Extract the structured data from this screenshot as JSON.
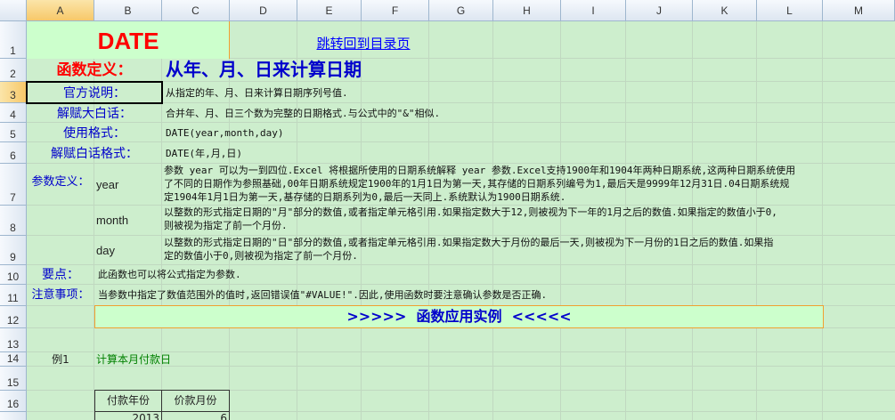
{
  "columns": [
    "A",
    "B",
    "C",
    "D",
    "E",
    "F",
    "G",
    "H",
    "I",
    "J",
    "K",
    "L",
    "M"
  ],
  "rows": [
    "1",
    "2",
    "3",
    "4",
    "5",
    "6",
    "7",
    "8",
    "9",
    "10",
    "11",
    "12",
    "13",
    "14",
    "15",
    "16",
    "17"
  ],
  "colors": {
    "accent_red": "#ff0000",
    "label_blue": "#0000cc",
    "link_blue": "#0000ff",
    "green_text": "#008000",
    "sheet_bg": "#cdeecd",
    "banner_border": "#f0a030"
  },
  "title": "DATE",
  "link_text": "跳转回到目录页",
  "definition_label": "函数定义：",
  "definition_text": "从年、月、日来计算日期",
  "rows_info": [
    {
      "label": "官方说明：",
      "text": "从指定的年、月、日来计算日期序列号值."
    },
    {
      "label": "解赋大白话：",
      "text": "合并年、月、日三个数为完整的日期格式.与公式中的\"&\"相似."
    },
    {
      "label": "使用格式：",
      "text": "DATE(year,month,day)"
    },
    {
      "label": "解赋白话格式：",
      "text": "DATE(年,月,日)"
    }
  ],
  "param_label": "参数定义：",
  "params": [
    {
      "name": "year",
      "lines": [
        "参数 year 可以为一到四位.Excel 将根据所使用的日期系统解释 year 参数.Excel支持1900年和1904年两种日期系统,这两种日期系统使用",
        "了不同的日期作为参照基础,00年日期系统规定1900年的1月1日为第一天,其存储的日期系列编号为1,最后天是9999年12月31日.04日期系统规",
        "定1904年1月1日为第一天,基存储的日期系列为0,最后一天同上.系统默认为1900日期系统."
      ]
    },
    {
      "name": "month",
      "lines": [
        "以整数的形式指定日期的\"月\"部分的数值,或者指定单元格引用.如果指定数大于12,则被视为下一年的1月之后的数值.如果指定的数值小于0,",
        "则被视为指定了前一个月份."
      ]
    },
    {
      "name": "day",
      "lines": [
        "以整数的形式指定日期的\"日\"部分的数值,或者指定单元格引用.如果指定数大于月份的最后一天,则被视为下一月份的1日之后的数值.如果指",
        "定的数值小于0,则被视为指定了前一个月份."
      ]
    }
  ],
  "keypoint_label": "要点：",
  "keypoint_text": "此函数也可以将公式指定为参数.",
  "notes_label": "注意事项：",
  "notes_text": "当参数中指定了数值范围外的值时,返回错误值\"#VALUE!\".因此,使用函数时要注意确认参数是否正确.",
  "banner": ">>>>>  函数应用实例  <<<<<",
  "example_label": "例1",
  "example_title": "计算本月付款日",
  "table": {
    "headers": [
      "付款年份",
      "价款月份"
    ],
    "row": [
      "2013",
      "6"
    ]
  }
}
